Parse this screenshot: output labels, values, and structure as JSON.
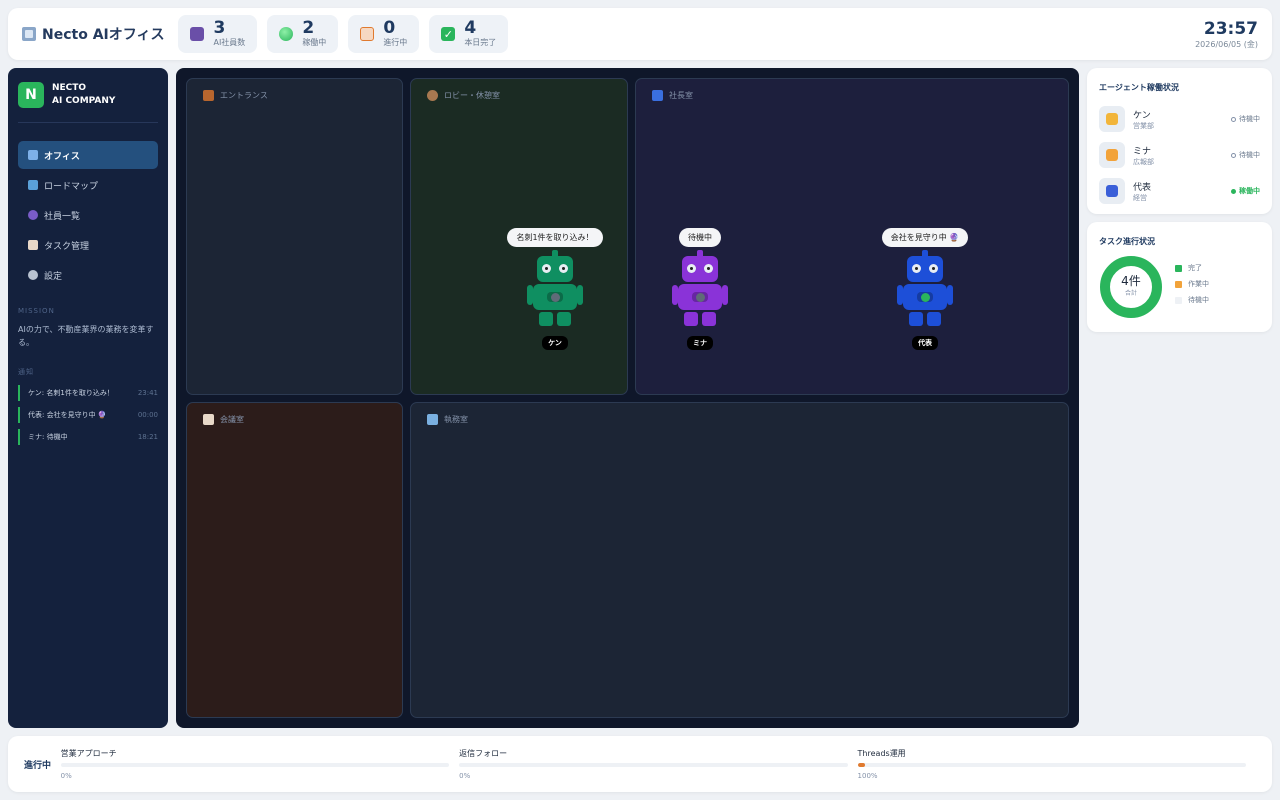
{
  "header": {
    "title": "Necto AIオフィス",
    "stats": [
      {
        "value": "3",
        "label": "AI社員数",
        "icon": "people-icon",
        "color": "#6a4fa8"
      },
      {
        "value": "2",
        "label": "稼働中",
        "icon": "green-dot-icon",
        "color": "#2ab55c"
      },
      {
        "value": "0",
        "label": "進行中",
        "icon": "clipboard-icon",
        "color": "#e07a2f"
      },
      {
        "value": "4",
        "label": "本日完了",
        "icon": "check-icon",
        "color": "#2ab55c"
      }
    ],
    "time": "23:57",
    "date": "2026/06/05 (金)"
  },
  "sidebar": {
    "logo_letter": "N",
    "company_line1": "NECTO",
    "company_line2": "AI COMPANY",
    "nav": [
      {
        "label": "オフィス",
        "active": true,
        "icon": "chart-icon"
      },
      {
        "label": "ロードマップ",
        "active": false,
        "icon": "map-icon"
      },
      {
        "label": "社員一覧",
        "active": false,
        "icon": "person-icon"
      },
      {
        "label": "タスク管理",
        "active": false,
        "icon": "clipboard-icon"
      },
      {
        "label": "設定",
        "active": false,
        "icon": "gear-icon"
      }
    ],
    "mission_heading": "MISSION",
    "mission_text": "AIの力で、不動産業界の業務を変革する。",
    "notifications_heading": "通知",
    "notifications": [
      {
        "text": "ケン: 名刺1件を取り込み！",
        "time": "23:41"
      },
      {
        "text": "代表: 会社を見守り中 🔮",
        "time": "00:00"
      },
      {
        "text": "ミナ: 待機中",
        "time": "18:21"
      }
    ]
  },
  "office": {
    "rooms": [
      {
        "label": "エントランス",
        "icon": "door-icon",
        "bg": "#1c2535"
      },
      {
        "label": "ロビー・休憩室",
        "icon": "coffee-icon",
        "bg": "#1b2b23"
      },
      {
        "label": "社長室",
        "icon": "suit-icon",
        "bg": "#1d1f3d"
      },
      {
        "label": "会議室",
        "icon": "clipboard-icon",
        "bg": "#2c1c1a"
      },
      {
        "label": "執務室",
        "icon": "laptop-icon",
        "bg": "#1c2535"
      }
    ],
    "agents": [
      {
        "name": "ケン",
        "bubble": "名刺1件を取り込み！",
        "color": "#0f8f61",
        "light": "#5f6b78"
      },
      {
        "name": "ミナ",
        "bubble": "待機中",
        "color": "#8a33d8",
        "light": "#5f6b78"
      },
      {
        "name": "代表",
        "bubble": "会社を見守り中 🔮",
        "color": "#1d4fd8",
        "light": "#2ab55c"
      }
    ]
  },
  "agent_status": {
    "title": "エージェント稼働状況",
    "agents": [
      {
        "name": "ケン",
        "dept": "営業部",
        "status": "待機中",
        "active": false,
        "icon": "handshake-icon",
        "icon_color": "#f2b53a"
      },
      {
        "name": "ミナ",
        "dept": "広報部",
        "status": "待機中",
        "active": false,
        "icon": "writing-hand-icon",
        "icon_color": "#f2a33a"
      },
      {
        "name": "代表",
        "dept": "経営",
        "status": "稼働中",
        "active": true,
        "icon": "suit-icon",
        "icon_color": "#3a5fd8"
      }
    ]
  },
  "task_progress": {
    "title": "タスク進行状況",
    "center_value": "4件",
    "center_label": "合計",
    "legend": [
      {
        "label": "完了",
        "color": "#2ab55c",
        "value": 4
      },
      {
        "label": "作業中",
        "color": "#f2a33a",
        "value": 0
      },
      {
        "label": "待機中",
        "color": "#eef1f5",
        "value": 0
      }
    ]
  },
  "bottom": {
    "label": "進行中",
    "projects": [
      {
        "name": "営業アプローチ",
        "percent": "0%",
        "fraction": 0
      },
      {
        "name": "返信フォロー",
        "percent": "0%",
        "fraction": 0
      },
      {
        "name": "Threads運用",
        "percent": "100%",
        "fraction": 0.02
      }
    ]
  }
}
